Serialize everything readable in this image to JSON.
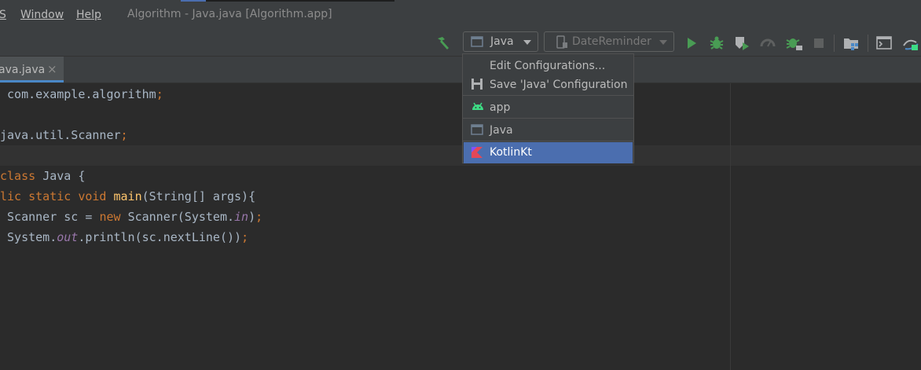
{
  "menubar": {
    "vcs_fragment": "S",
    "window": "Window",
    "help": "Help",
    "title": "Algorithm - Java.java [Algorithm.app]"
  },
  "toolbar": {
    "run_config": "Java",
    "device": "DateReminder",
    "icons": [
      "hammer-icon",
      "java-config-icon",
      "phone-icon",
      "run-icon",
      "debug-icon",
      "coverage-icon",
      "profile-icon",
      "attach-debugger-icon",
      "stop-icon",
      "project-structure-icon",
      "terminal-icon",
      "sync-icon"
    ]
  },
  "tab": {
    "label": "ava.java",
    "close": "×"
  },
  "editor": {
    "lines": [
      {
        "parts": [
          {
            "t": " com.example.algorithm",
            "c": ""
          },
          {
            "t": ";",
            "c": "sc"
          }
        ]
      },
      {
        "parts": []
      },
      {
        "parts": [
          {
            "t": "java.util.Scanner",
            "c": ""
          },
          {
            "t": ";",
            "c": "sc"
          }
        ]
      },
      {
        "parts": []
      },
      {
        "parts": [
          {
            "t": "class ",
            "c": "kw"
          },
          {
            "t": "Java {",
            "c": ""
          }
        ]
      },
      {
        "parts": [
          {
            "t": "lic static void ",
            "c": "kw"
          },
          {
            "t": "main",
            "c": "fn"
          },
          {
            "t": "(String[] args){",
            "c": ""
          }
        ]
      },
      {
        "parts": [
          {
            "t": " Scanner sc = ",
            "c": ""
          },
          {
            "t": "new ",
            "c": "kw"
          },
          {
            "t": "Scanner(System.",
            "c": ""
          },
          {
            "t": "in",
            "c": "st"
          },
          {
            "t": ")",
            "c": ""
          },
          {
            "t": ";",
            "c": "sc"
          }
        ]
      },
      {
        "parts": [
          {
            "t": " System.",
            "c": ""
          },
          {
            "t": "out",
            "c": "st"
          },
          {
            "t": ".println(sc.nextLine())",
            "c": ""
          },
          {
            "t": ";",
            "c": "sc"
          }
        ]
      }
    ]
  },
  "dropdown": {
    "edit_configurations": "Edit Configurations...",
    "save_configuration": "Save 'Java' Configuration",
    "configs": [
      "app",
      "Java",
      "KotlinKt"
    ],
    "selected": "KotlinKt"
  },
  "colors": {
    "background": "#2b2b2b",
    "panel": "#3c3f41",
    "selection": "#4b6eaf",
    "keyword": "#cc7832",
    "function": "#ffc66d",
    "static_field": "#9876aa",
    "run_green": "#499c54",
    "android_green": "#3ddc84"
  }
}
